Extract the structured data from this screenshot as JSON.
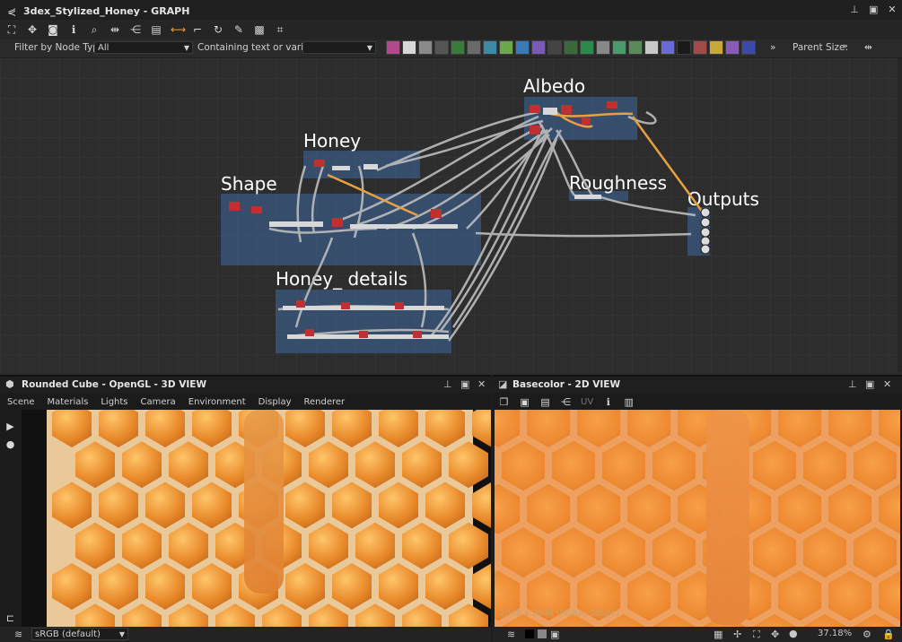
{
  "graph": {
    "title": "3dex_Stylized_Honey - GRAPH",
    "filter_label": "Filter by Node Type",
    "filter_value": "All",
    "containing_label": "Containing text or variable",
    "more_glyph": "»",
    "parent_size_label": "Parent Size:",
    "frames": {
      "albedo": "Albedo",
      "honey": "Honey",
      "shape": "Shape",
      "roughness": "Roughness",
      "outputs": "Outputs",
      "honey_details": "Honey_ details"
    }
  },
  "view3d": {
    "title": "Rounded Cube - OpenGL - 3D VIEW",
    "menu": [
      "Scene",
      "Materials",
      "Lights",
      "Camera",
      "Environment",
      "Display",
      "Renderer"
    ],
    "colorspace": "sRGB (default)"
  },
  "view2d": {
    "title": "Basecolor - 2D VIEW",
    "uv_label": "UV",
    "resolution": "2048 x 2048 (RGBA, 16bpc)",
    "zoom": "37.18%"
  },
  "colors": {
    "frame": "#3e68a0",
    "orange_wire": "#e8a040",
    "honey": "#e8892a",
    "wax": "#e9c89a"
  },
  "icons": {
    "toolbar": [
      "fit-icon",
      "center-icon",
      "camera-icon",
      "info-icon",
      "search-icon",
      "link-icon",
      "hierarchy-icon",
      "layout-icon",
      "connect-icon",
      "route-icon",
      "refresh-icon",
      "tools-icon",
      "snapshot-icon",
      "frame-icon"
    ]
  }
}
